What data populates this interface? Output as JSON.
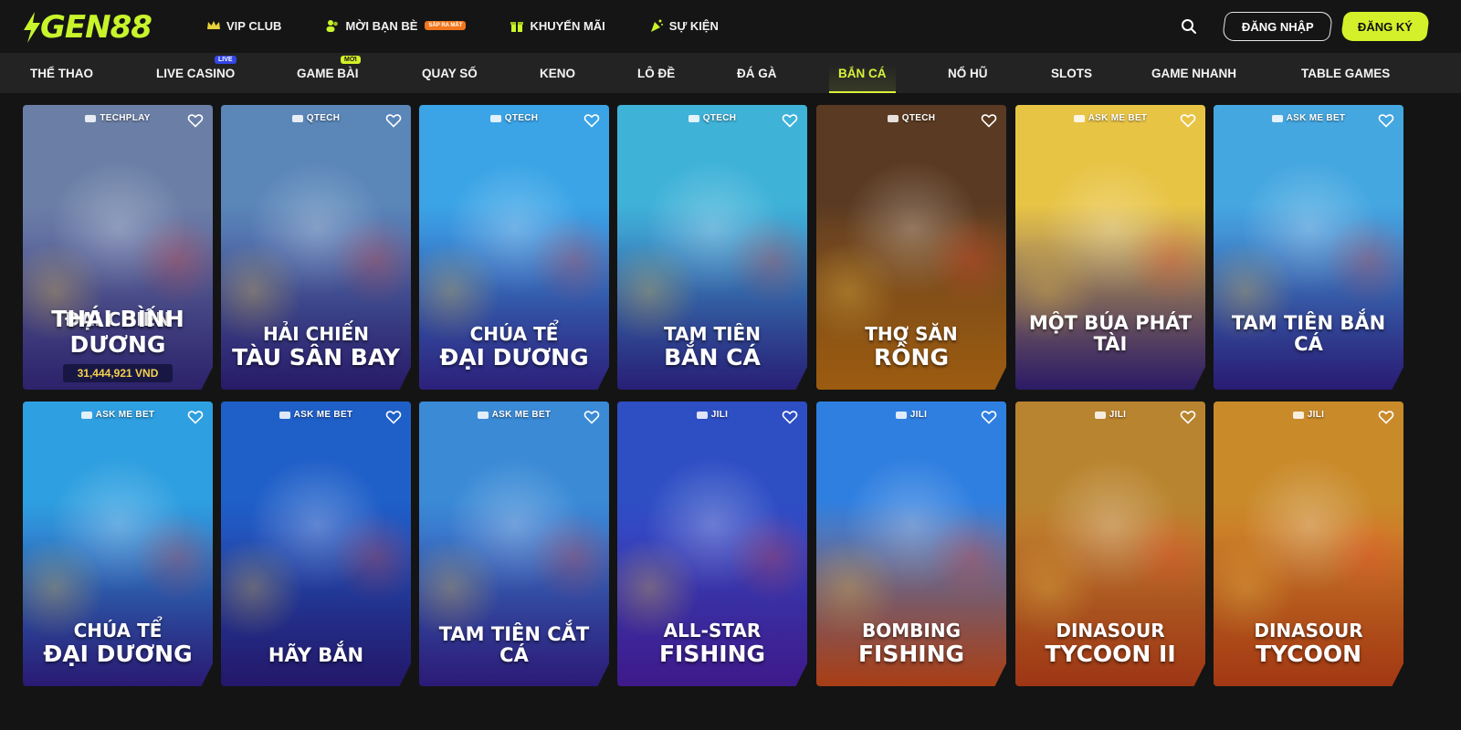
{
  "brand": {
    "logo_text": "GEN88"
  },
  "header": {
    "nav": [
      {
        "label": "VIP CLUB",
        "icon": "crown-icon"
      },
      {
        "label": "MỜI BẠN BÈ",
        "icon": "users-icon",
        "badge": "SẮP RA MẮT"
      },
      {
        "label": "KHUYẾN MÃI",
        "icon": "gift-icon"
      },
      {
        "label": "SỰ KIỆN",
        "icon": "party-icon"
      }
    ],
    "login_label": "ĐĂNG NHẬP",
    "register_label": "ĐĂNG KÝ",
    "colors": {
      "accent": "#d4f02a",
      "background": "#151515",
      "category_bar": "#232323"
    }
  },
  "categories": [
    {
      "label": "THỂ THAO"
    },
    {
      "label": "LIVE CASINO",
      "tag": "LIVE"
    },
    {
      "label": "GAME BÀI",
      "tag": "MỚI"
    },
    {
      "label": "QUAY SỐ"
    },
    {
      "label": "KENO"
    },
    {
      "label": "LÔ ĐỀ"
    },
    {
      "label": "ĐÁ GÀ"
    },
    {
      "label": "BẮN CÁ",
      "active": true
    },
    {
      "label": "NỔ HŨ"
    },
    {
      "label": "SLOTS"
    },
    {
      "label": "GAME NHANH"
    },
    {
      "label": "TABLE GAMES"
    }
  ],
  "games": [
    {
      "provider": "TECHPLAY",
      "line1": "ĐẠI CHIẾN",
      "line2": "THÁI BÌNH DƯƠNG",
      "jackpot": "31,444,921 VND",
      "bg": [
        "#6b7fa6",
        "#3b2d8f"
      ]
    },
    {
      "provider": "QTECH",
      "line1": "HẢI CHIẾN",
      "line2": "TÀU SÂN BAY",
      "bg": [
        "#5a86b8",
        "#35238a"
      ]
    },
    {
      "provider": "QTECH",
      "line1": "CHÚA TỂ",
      "line2": "ĐẠI DƯƠNG",
      "bg": [
        "#3aa4e6",
        "#3b2ba3"
      ]
    },
    {
      "provider": "QTECH",
      "line1": "TAM TIÊN",
      "line2": "BẮN CÁ",
      "bg": [
        "#3fb2d8",
        "#352a9e"
      ]
    },
    {
      "provider": "QTECH",
      "line1": "THỢ SĂN",
      "line2": "RỒNG",
      "bg": [
        "#5a3a22",
        "#d07a15"
      ]
    },
    {
      "provider": "ASK ME BET",
      "line1": "",
      "line2": "MỘT BÚA PHÁT TÀI",
      "bg": [
        "#e8c445",
        "#3a2488"
      ]
    },
    {
      "provider": "ASK ME BET",
      "line1": "",
      "line2": "TAM TIÊN BẮN CÁ",
      "bg": [
        "#45a7e0",
        "#36259b"
      ]
    },
    {
      "provider": "ASK ME BET",
      "line1": "CHÚA TỂ",
      "line2": "ĐẠI DƯƠNG",
      "bg": [
        "#2e9fe0",
        "#37239a"
      ]
    },
    {
      "provider": "ASK ME BET",
      "line1": "",
      "line2": "HÃY BẮN",
      "bg": [
        "#1f5fc8",
        "#2f1f8c"
      ]
    },
    {
      "provider": "ASK ME BET",
      "line1": "",
      "line2": "TAM TIÊN CẮT CÁ",
      "bg": [
        "#3a8ad6",
        "#3a239e"
      ]
    },
    {
      "provider": "JILI",
      "line1": "ALL-STAR",
      "line2": "FISHING",
      "bg": [
        "#2e4ec4",
        "#5322b8"
      ]
    },
    {
      "provider": "JILI",
      "line1": "BOMBING",
      "line2": "FISHING",
      "bg": [
        "#2f7fe0",
        "#e0531c"
      ]
    },
    {
      "provider": "JILI",
      "line1": "DINASOUR",
      "line2": "TYCOON II",
      "bg": [
        "#b9842f",
        "#d2481c"
      ]
    },
    {
      "provider": "JILI",
      "line1": "DINASOUR",
      "line2": "TYCOON",
      "bg": [
        "#c98a2a",
        "#d94a1a"
      ]
    }
  ]
}
